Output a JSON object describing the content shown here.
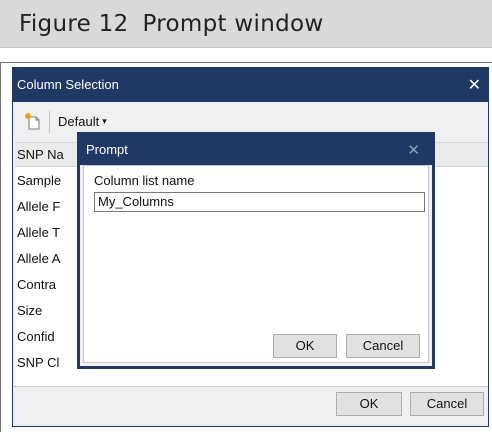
{
  "figure": {
    "number": "Figure 12",
    "caption": "Prompt window"
  },
  "window": {
    "title": "Column Selection",
    "close_glyph": "✕",
    "toolbar": {
      "dropdown_label": "Default",
      "caret": "▾"
    },
    "list_items": [
      "SNP Na",
      "Sample",
      "Allele F",
      "Allele T",
      "Allele A",
      "Contra",
      "Size",
      "Confid",
      "SNP Cl"
    ],
    "ok_label": "OK",
    "cancel_label": "Cancel"
  },
  "prompt": {
    "title": "Prompt",
    "close_glyph": "✕",
    "field_label": "Column list name",
    "field_value": "My_Columns",
    "ok_label": "OK",
    "cancel_label": "Cancel"
  },
  "colors": {
    "titlebar": "#203864",
    "figure_band": "#d9d9d9"
  }
}
